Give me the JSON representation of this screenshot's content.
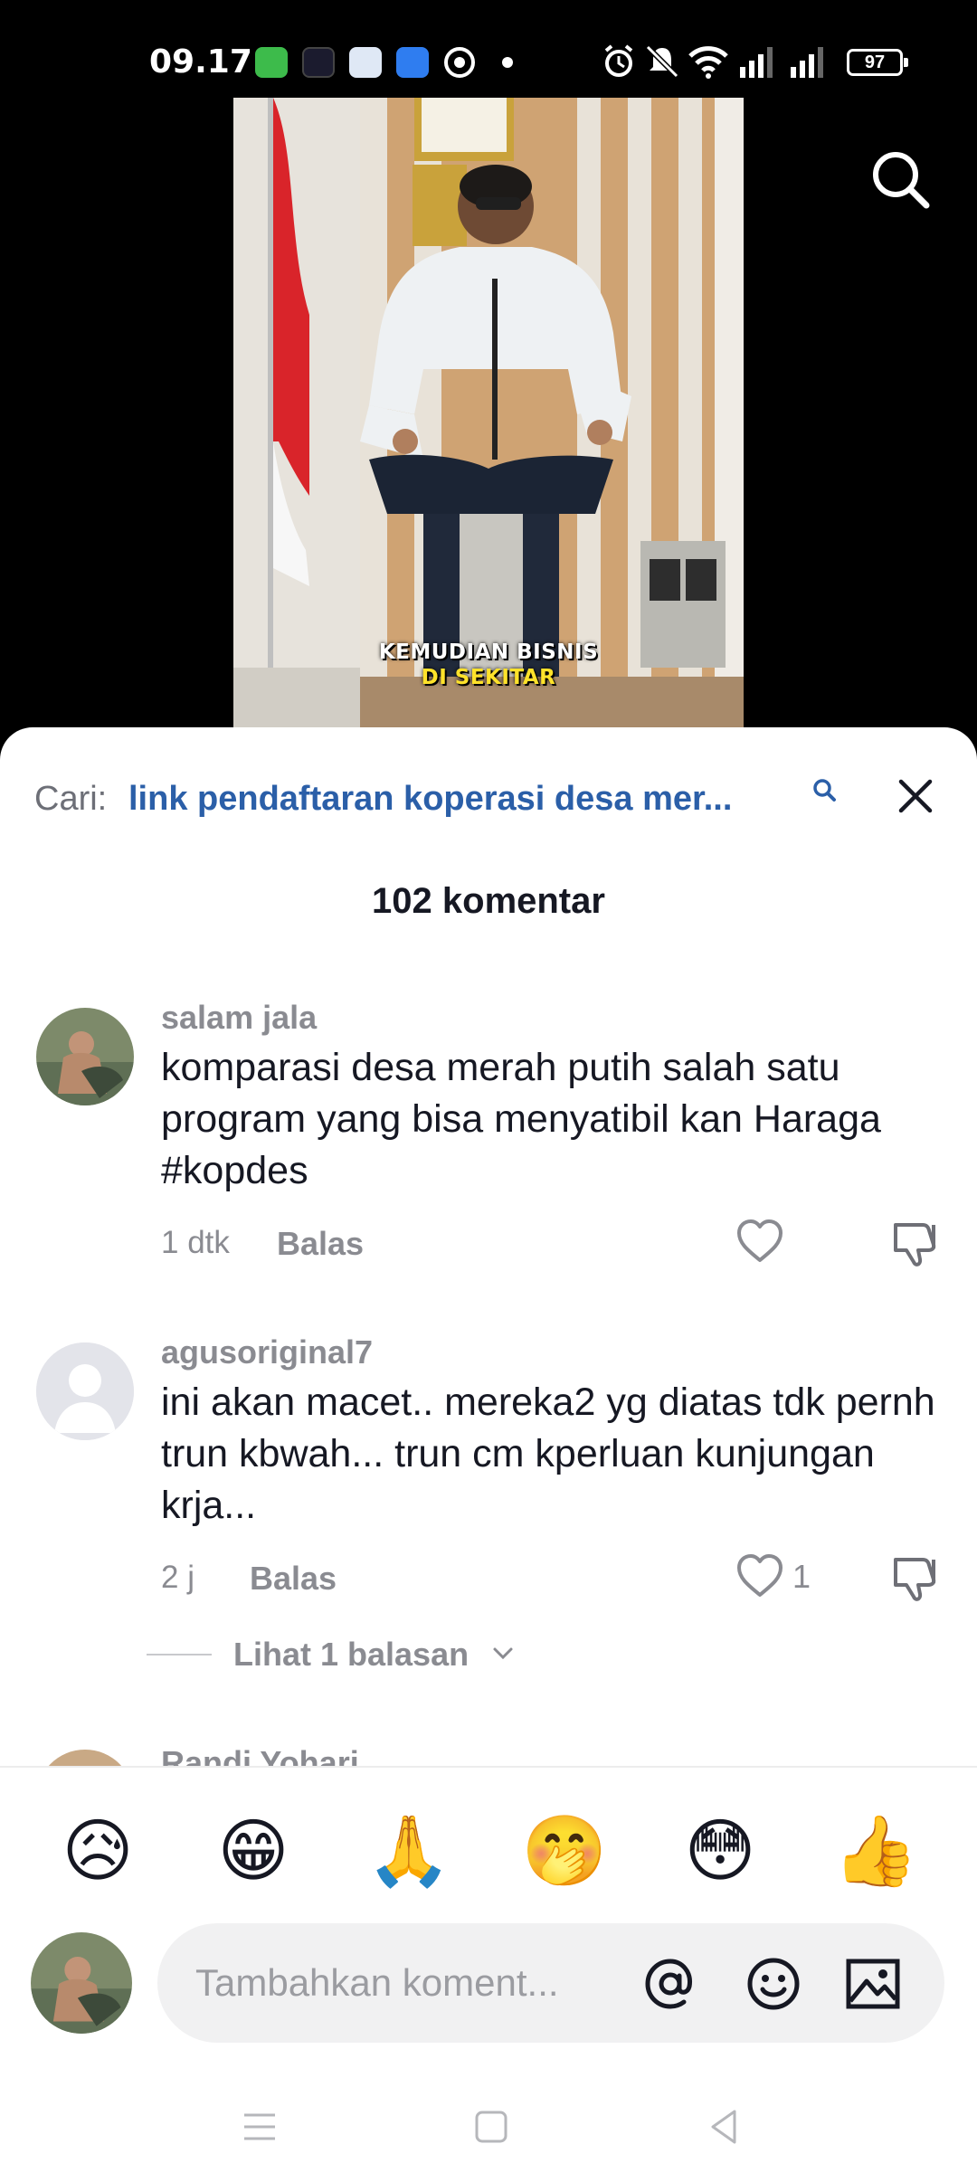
{
  "status_bar": {
    "time": "09.17",
    "battery": "97"
  },
  "video": {
    "caption_line1": "KEMUDIAN BISNIS",
    "caption_line2": "DI SEKITAR"
  },
  "sheet": {
    "search_prefix": "Cari:",
    "search_query": "link pendaftaran koperasi desa mer...",
    "comment_count": "102 komentar"
  },
  "comments": [
    {
      "username": "salam jala",
      "text": "komparasi desa merah putih salah satu program yang bisa menyatibil kan Haraga #kopdes",
      "time": "1 dtk",
      "reply_label": "Balas",
      "likes": ""
    },
    {
      "username": "agusoriginal7",
      "text": "ini akan macet.. mereka2 yg diatas tdk pernh trun kbwah... trun cm kperluan kunjungan krja...",
      "time": "2 j",
      "reply_label": "Balas",
      "likes": "1",
      "view_replies": "Lihat 1 balasan"
    },
    {
      "username": "Randi Yohari"
    }
  ],
  "composer": {
    "emojis": [
      "😥",
      "😁",
      "🙏",
      "🤭",
      "😳",
      "👍"
    ],
    "placeholder": "Tambahkan koment..."
  }
}
